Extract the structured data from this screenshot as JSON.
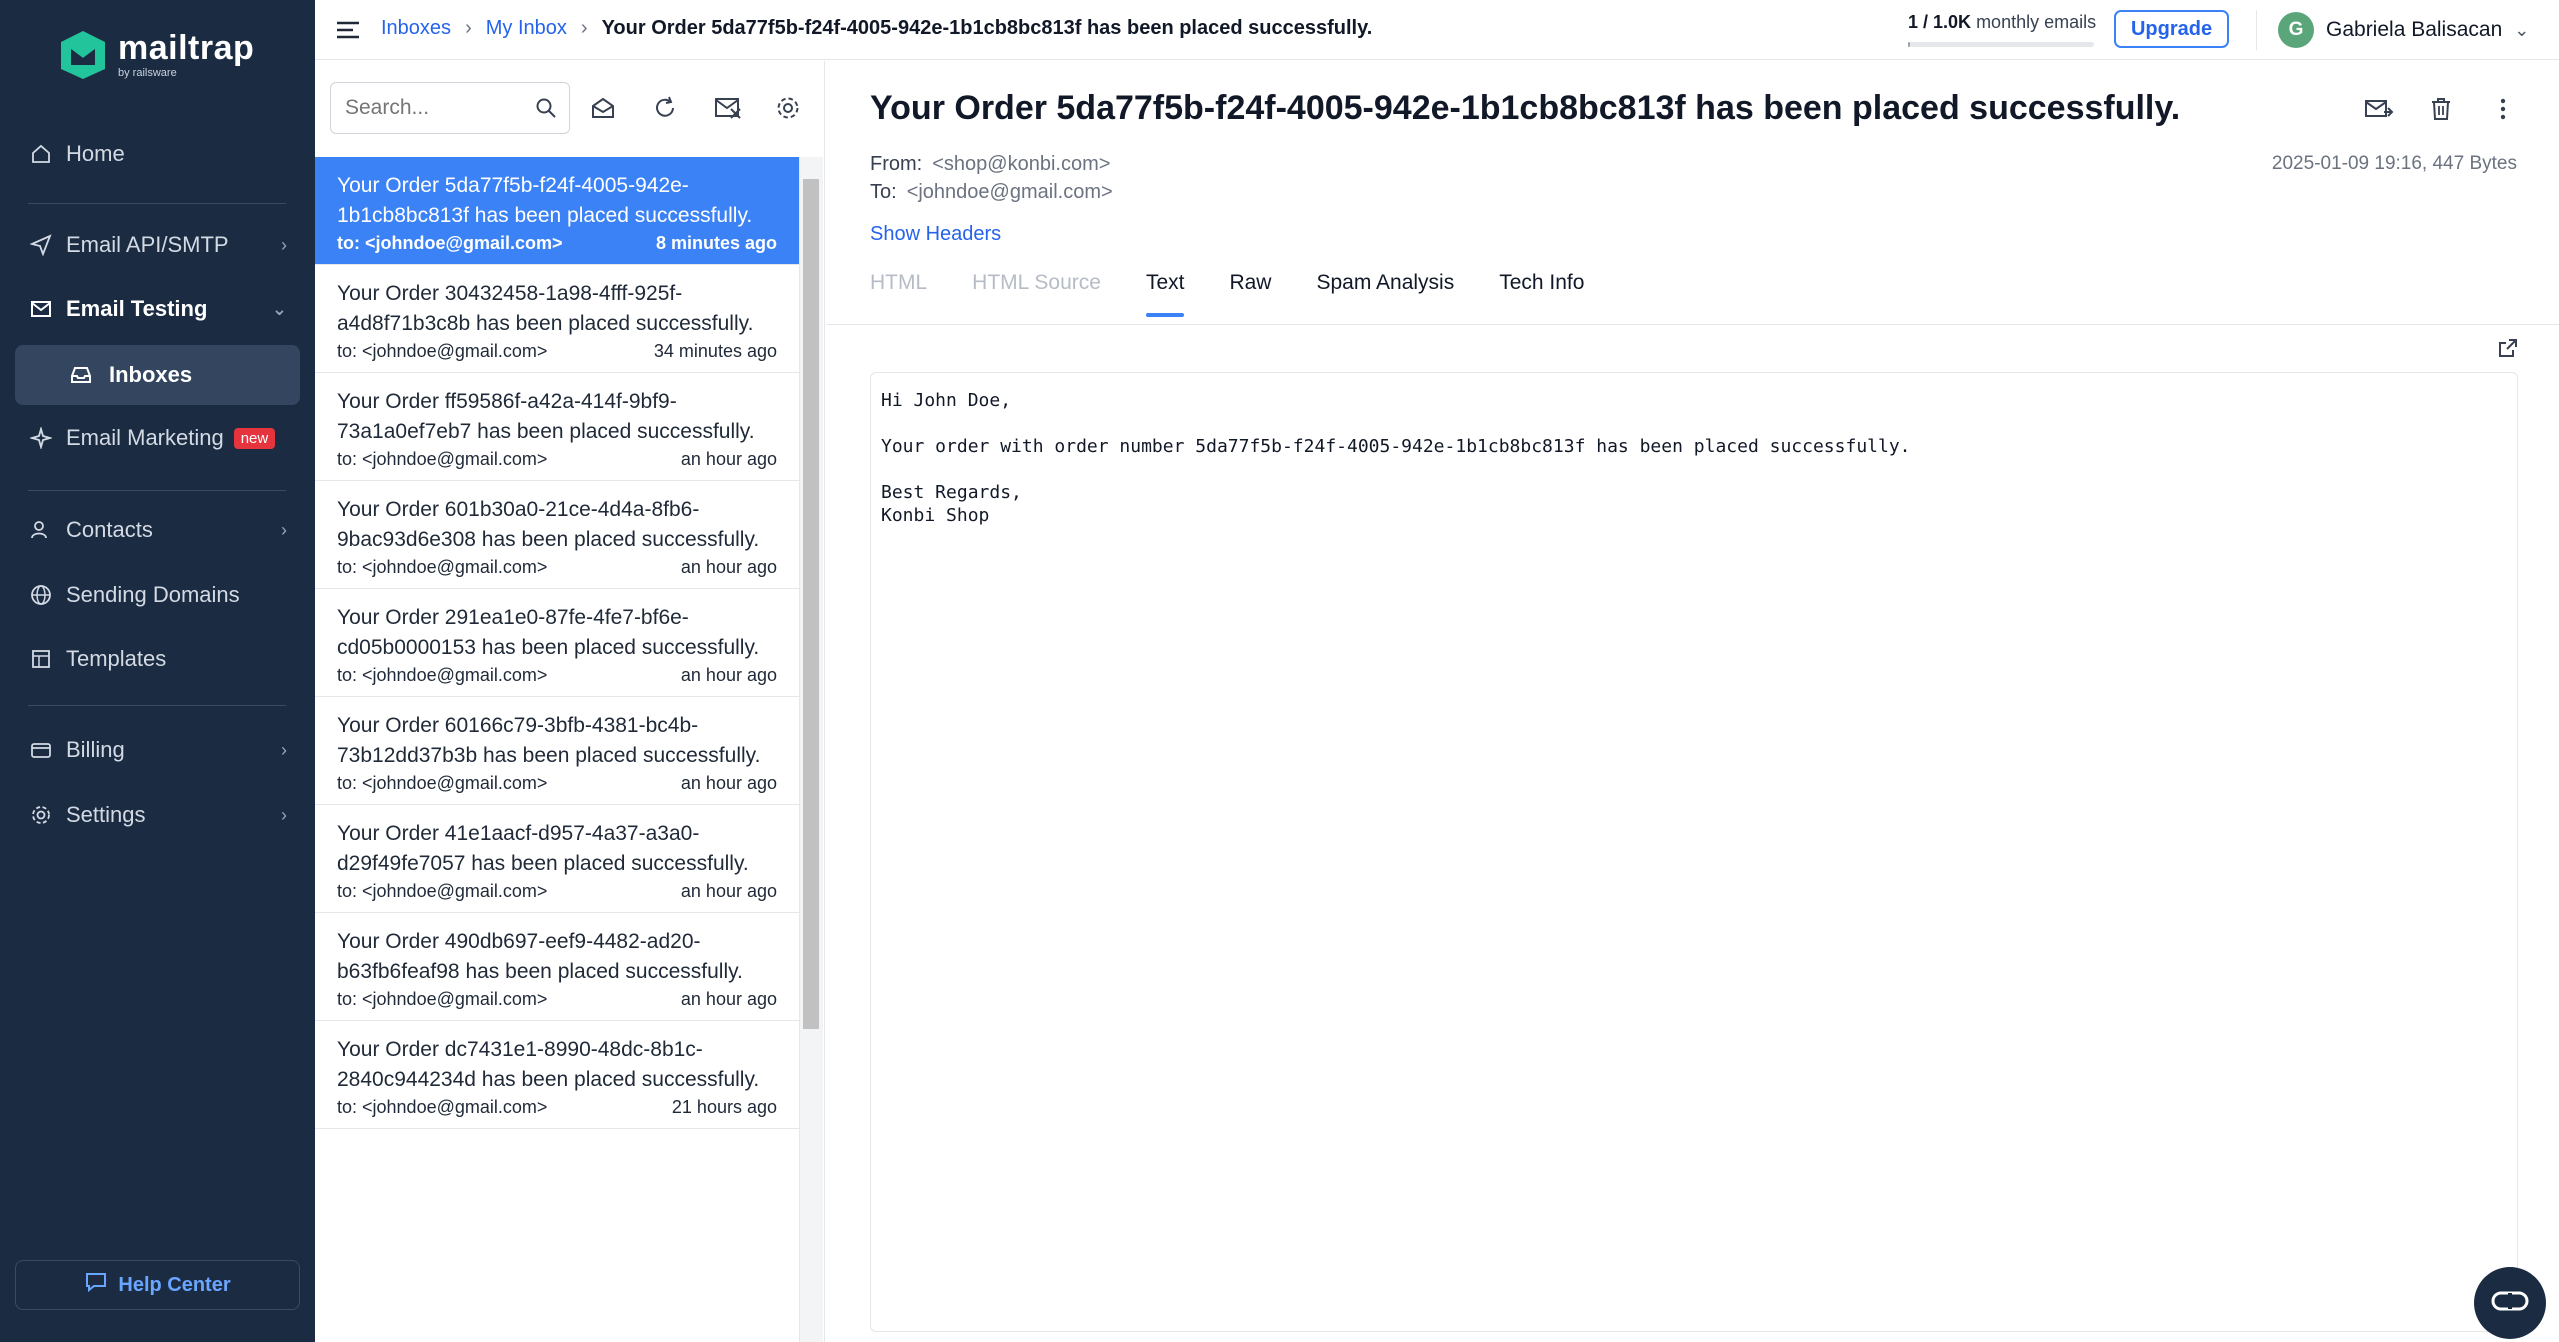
{
  "brand": {
    "name": "mailtrap",
    "sub": "by railsware"
  },
  "sidebar": {
    "items": [
      {
        "label": "Home"
      },
      {
        "label": "Email API/SMTP"
      },
      {
        "label": "Email Testing"
      },
      {
        "label": "Inboxes"
      },
      {
        "label": "Email Marketing",
        "badge": "new"
      },
      {
        "label": "Contacts"
      },
      {
        "label": "Sending Domains"
      },
      {
        "label": "Templates"
      },
      {
        "label": "Billing"
      },
      {
        "label": "Settings"
      }
    ],
    "help": "Help Center"
  },
  "topbar": {
    "breadcrumb": [
      "Inboxes",
      "My Inbox",
      "Your Order 5da77f5b-f24f-4005-942e-1b1cb8bc813f has been placed successfully."
    ],
    "quota_used": "1 / 1.0K",
    "quota_label": "monthly emails",
    "quota_fraction": 0.001,
    "upgrade": "Upgrade",
    "user_initial": "G",
    "user_name": "Gabriela Balisacan"
  },
  "list": {
    "search_placeholder": "Search...",
    "emails": [
      {
        "subject": "Your Order 5da77f5b-f24f-4005-942e-1b1cb8bc813f has been placed successfully.",
        "to": "to: <johndoe@gmail.com>",
        "time": "8 minutes ago",
        "selected": true
      },
      {
        "subject": "Your Order 30432458-1a98-4fff-925f-a4d8f71b3c8b has been placed successfully.",
        "to": "to: <johndoe@gmail.com>",
        "time": "34 minutes ago"
      },
      {
        "subject": "Your Order ff59586f-a42a-414f-9bf9-73a1a0ef7eb7 has been placed successfully.",
        "to": "to: <johndoe@gmail.com>",
        "time": "an hour ago"
      },
      {
        "subject": "Your Order 601b30a0-21ce-4d4a-8fb6-9bac93d6e308 has been placed successfully.",
        "to": "to: <johndoe@gmail.com>",
        "time": "an hour ago"
      },
      {
        "subject": "Your Order 291ea1e0-87fe-4fe7-bf6e-cd05b0000153 has been placed successfully.",
        "to": "to: <johndoe@gmail.com>",
        "time": "an hour ago"
      },
      {
        "subject": "Your Order 60166c79-3bfb-4381-bc4b-73b12dd37b3b has been placed successfully.",
        "to": "to: <johndoe@gmail.com>",
        "time": "an hour ago"
      },
      {
        "subject": "Your Order 41e1aacf-d957-4a37-a3a0-d29f49fe7057 has been placed successfully.",
        "to": "to: <johndoe@gmail.com>",
        "time": "an hour ago"
      },
      {
        "subject": "Your Order 490db697-eef9-4482-ad20-b63fb6feaf98 has been placed successfully.",
        "to": "to: <johndoe@gmail.com>",
        "time": "an hour ago"
      },
      {
        "subject": "Your Order dc7431e1-8990-48dc-8b1c-2840c944234d has been placed successfully.",
        "to": "to: <johndoe@gmail.com>",
        "time": "21 hours ago"
      }
    ]
  },
  "message": {
    "title": "Your Order 5da77f5b-f24f-4005-942e-1b1cb8bc813f has been placed successfully.",
    "from_label": "From:",
    "from": "<shop@konbi.com>",
    "to_label": "To:",
    "to": "<johndoe@gmail.com>",
    "date_size": "2025-01-09 19:16, 447 Bytes",
    "show_headers": "Show Headers",
    "tabs": [
      {
        "label": "HTML",
        "state": "disabled"
      },
      {
        "label": "HTML Source",
        "state": "disabled"
      },
      {
        "label": "Text",
        "state": "active"
      },
      {
        "label": "Raw",
        "state": "normal"
      },
      {
        "label": "Spam Analysis",
        "state": "normal"
      },
      {
        "label": "Tech Info",
        "state": "normal"
      }
    ],
    "body": "Hi John Doe,\n\nYour order with order number 5da77f5b-f24f-4005-942e-1b1cb8bc813f has been placed successfully.\n\nBest Regards,\nKonbi Shop"
  },
  "colors": {
    "sidebar": "#1b2b42",
    "accent": "#3b82f6",
    "link": "#2563eb",
    "badge": "#e5343d"
  }
}
